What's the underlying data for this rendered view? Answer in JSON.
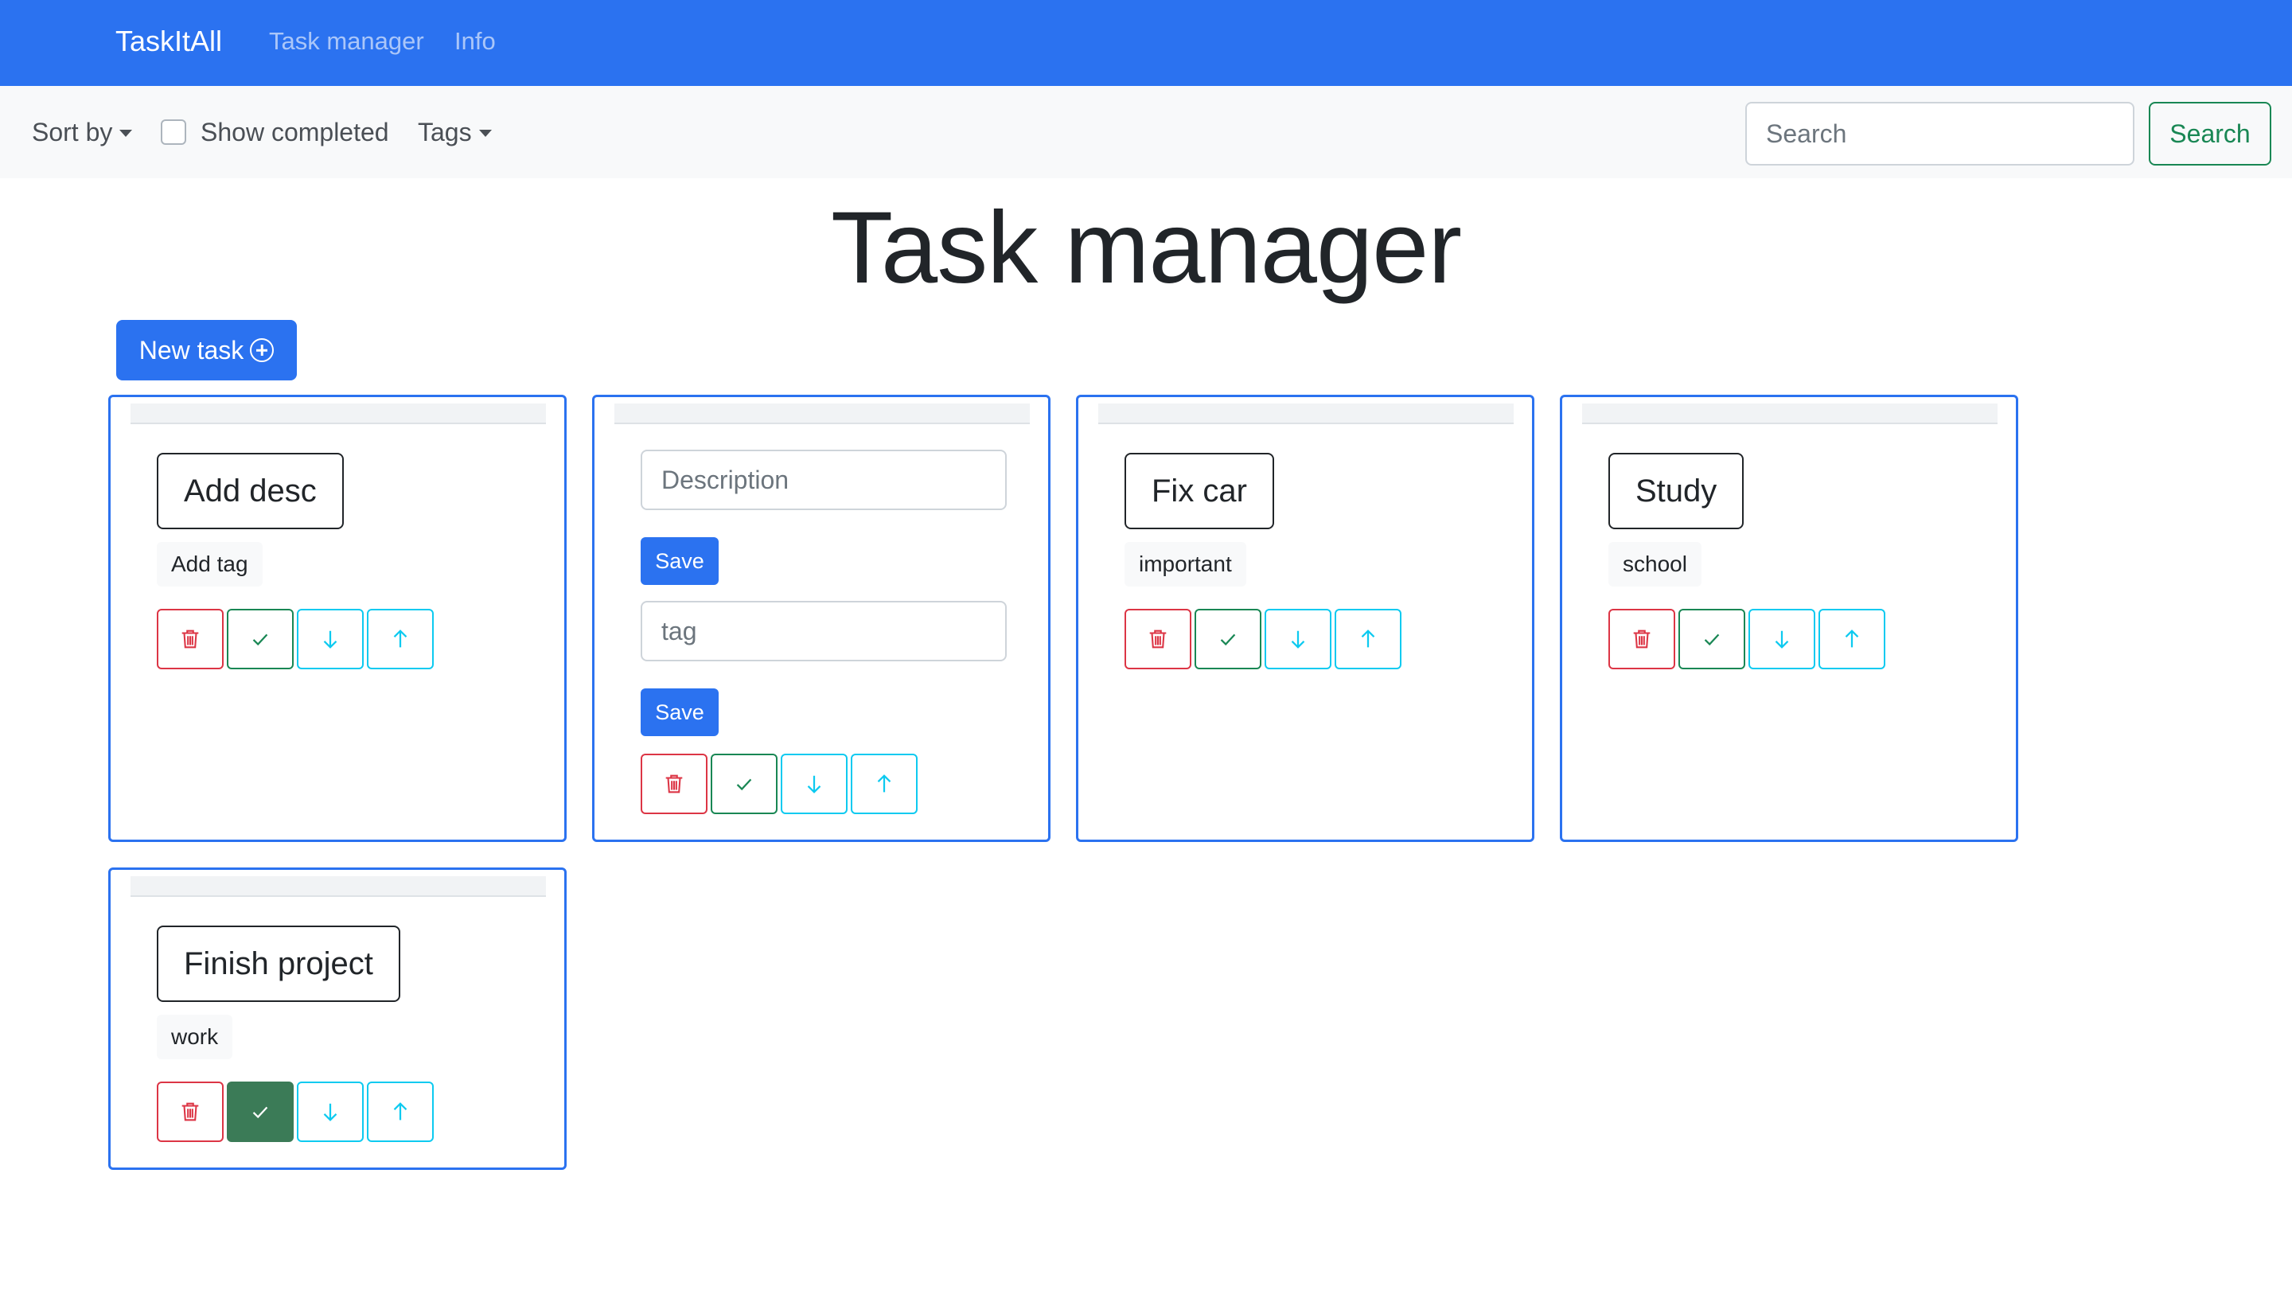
{
  "navbar": {
    "brand": "TaskItAll",
    "links": [
      "Task manager",
      "Info"
    ]
  },
  "toolbar": {
    "sort_label": "Sort by",
    "show_completed_label": "Show completed",
    "show_completed_checked": false,
    "tags_label": "Tags",
    "search_placeholder": "Search",
    "search_button": "Search"
  },
  "page": {
    "title": "Task manager",
    "new_task_label": "New task"
  },
  "cards": [
    {
      "title": "Add desc",
      "tag": "Add tag",
      "completed": false
    },
    {
      "editing": true,
      "description_placeholder": "Description",
      "tag_placeholder": "tag",
      "save_label": "Save",
      "save_label_2": "Save",
      "completed": false
    },
    {
      "title": "Fix car",
      "tag": "important",
      "completed": false
    },
    {
      "title": "Study",
      "tag": "school",
      "completed": false
    },
    {
      "title": "Finish project",
      "tag": "work",
      "completed": true
    }
  ],
  "icons": {
    "delete": "trash-icon",
    "complete": "check-icon",
    "move_down": "arrow-down-icon",
    "move_up": "arrow-up-icon",
    "new_task": "plus-circle-icon"
  },
  "colors": {
    "primary": "#2b72f0",
    "danger": "#dc3545",
    "success": "#198754",
    "info": "#0dcaf0",
    "success_filled": "#3b7b57"
  }
}
